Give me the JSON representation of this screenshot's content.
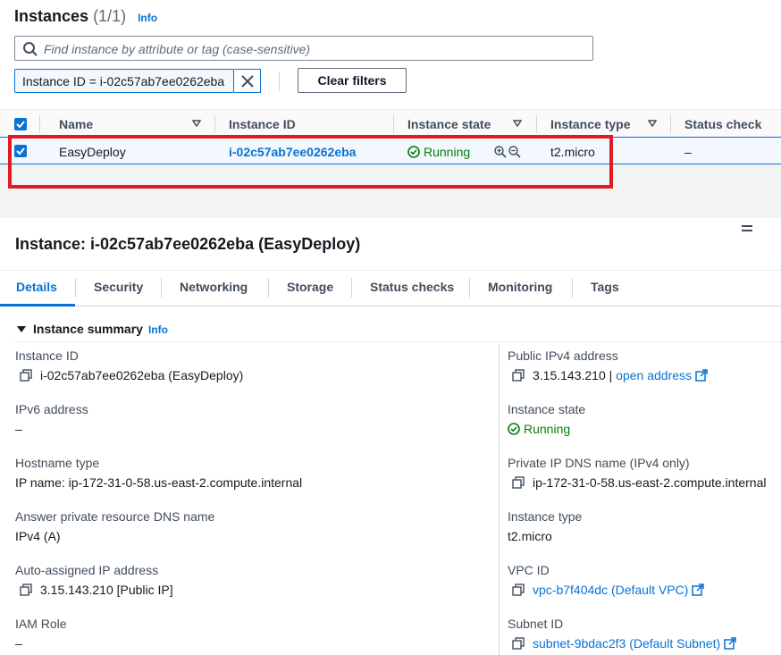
{
  "header": {
    "title": "Instances",
    "count": "(1/1)",
    "info": "Info"
  },
  "search": {
    "placeholder": "Find instance by attribute or tag (case-sensitive)"
  },
  "filter_token": "Instance ID = i-02c57ab7ee0262eba",
  "clear_filters": "Clear filters",
  "table": {
    "columns": [
      "Name",
      "Instance ID",
      "Instance state",
      "Instance type",
      "Status check"
    ],
    "rows": [
      {
        "name": "EasyDeploy",
        "instance_id": "i-02c57ab7ee0262eba",
        "state": "Running",
        "type": "t2.micro",
        "status_check": "–"
      }
    ]
  },
  "detail": {
    "title": "Instance: i-02c57ab7ee0262eba (EasyDeploy)",
    "tabs": [
      "Details",
      "Security",
      "Networking",
      "Storage",
      "Status checks",
      "Monitoring",
      "Tags"
    ],
    "active_tab": "Details",
    "summary_title": "Instance summary",
    "summary_info": "Info",
    "left": [
      {
        "label": "Instance ID",
        "value": "i-02c57ab7ee0262eba (EasyDeploy)"
      },
      {
        "label": "IPv6 address",
        "value": "–"
      },
      {
        "label": "Hostname type",
        "value": "IP name: ip-172-31-0-58.us-east-2.compute.internal"
      },
      {
        "label": "Answer private resource DNS name",
        "value": "IPv4 (A)"
      },
      {
        "label": "Auto-assigned IP address",
        "value": "3.15.143.210 [Public IP]"
      },
      {
        "label": "IAM Role",
        "value": "–"
      }
    ],
    "right": [
      {
        "label": "Public IPv4 address",
        "value": "3.15.143.210",
        "separator": " | ",
        "link": "open address"
      },
      {
        "label": "Instance state",
        "value": "Running"
      },
      {
        "label": "Private IP DNS name (IPv4 only)",
        "value": "ip-172-31-0-58.us-east-2.compute.internal"
      },
      {
        "label": "Instance type",
        "value": "t2.micro"
      },
      {
        "label": "VPC ID",
        "link": "vpc-b7f404dc (Default VPC)"
      },
      {
        "label": "Subnet ID",
        "link": "subnet-9bdac2f3 (Default Subnet)"
      }
    ]
  },
  "colors": {
    "accent": "#0972d3",
    "success": "#037f0c",
    "highlight": "#e01b24"
  }
}
